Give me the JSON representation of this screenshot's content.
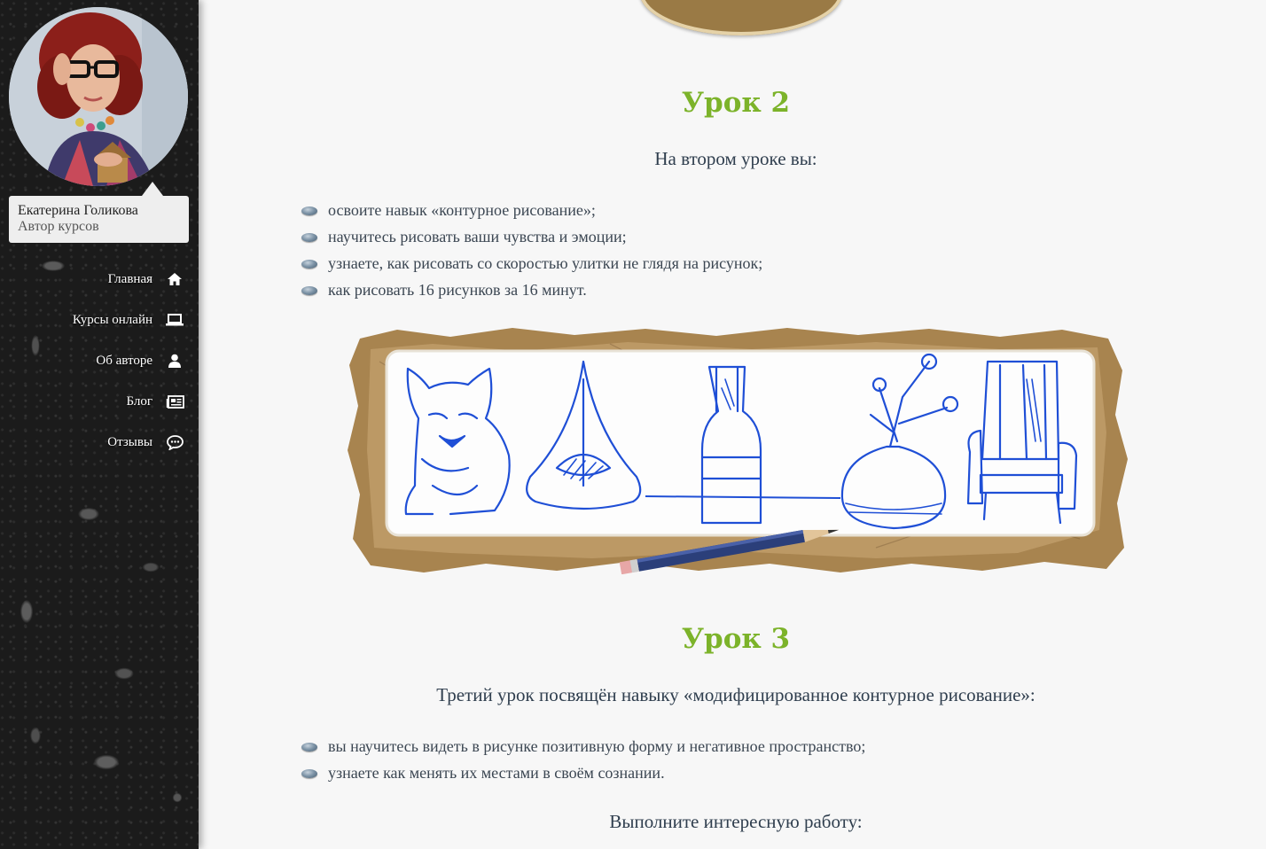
{
  "sidebar": {
    "author_name": "Екатерина Голикова",
    "author_role": "Автор курсов",
    "nav": [
      {
        "label": "Главная",
        "icon": "home-icon"
      },
      {
        "label": "Курсы онлайн",
        "icon": "laptop-icon"
      },
      {
        "label": "Об авторе",
        "icon": "user-icon"
      },
      {
        "label": "Блог",
        "icon": "newspaper-icon"
      },
      {
        "label": "Отзывы",
        "icon": "comment-icon"
      }
    ]
  },
  "lesson2": {
    "title": "Урок 2",
    "intro": "На втором уроке вы:",
    "items": [
      "освоите навык «контурное рисование»;",
      "научитесь рисовать ваши чувства и эмоции;",
      "узнаете, как рисовать со скоростью улитки не глядя на рисунок;",
      "как рисовать 16 рисунков за 16 минут."
    ]
  },
  "lesson3": {
    "title": "Урок 3",
    "intro": "Третий урок посвящён навыку «модифицированное контурное рисование»:",
    "items": [
      "вы научитесь видеть в рисунке позитивную форму и негативное пространство;",
      "узнаете как менять их местами в своём сознании."
    ],
    "task": "Выполните интересную работу:"
  },
  "colors": {
    "accent_green": "#7cb32a",
    "heading_dark": "#2f3e4e",
    "text": "#3b4652",
    "sketch_blue": "#1f4fd6"
  }
}
